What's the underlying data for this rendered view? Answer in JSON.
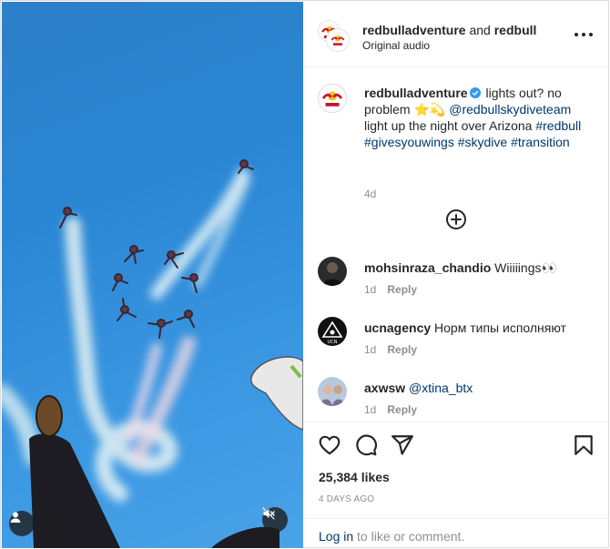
{
  "header": {
    "author": "redbulladventure",
    "and": "and",
    "coauthor": "redbull",
    "audio": "Original audio"
  },
  "caption": {
    "user": "redbulladventure",
    "text_lead": "lights out? no problem",
    "emoji": "⭐💫",
    "mention": "@redbullskydiveteam",
    "text_tail": "light up the night over Arizona",
    "hashtags": [
      "#redbull",
      "#givesyouwings",
      "#skydive",
      "#transition"
    ],
    "time": "4d"
  },
  "comments": [
    {
      "user": "mohsinraza_chandio",
      "text": "Wiiiiings",
      "emoji": "👀",
      "time": "1d",
      "reply": "Reply"
    },
    {
      "user": "ucnagency",
      "text": "Норм типы исполняют",
      "emoji": "",
      "time": "1d",
      "reply": "Reply"
    },
    {
      "user": "axwsw",
      "text": "@xtina_btx",
      "emoji": "",
      "time": "1d",
      "reply": "Reply"
    }
  ],
  "stats": {
    "likes": "25,384 likes",
    "date": "4 DAYS AGO"
  },
  "footer": {
    "login": "Log in",
    "rest": "to like or comment."
  },
  "icons": {
    "like": "heart-icon",
    "comment": "comment-bubble-icon",
    "share": "paper-plane-icon",
    "save": "bookmark-icon",
    "more": "more-options-icon",
    "load_more": "plus-circle-icon",
    "user_tags": "person-icon",
    "mute": "speaker-muted-icon"
  },
  "colors": {
    "link": "#00376b",
    "muted": "#8e8e8e",
    "sky": "#2a86d3",
    "verified": "#3897f0"
  }
}
